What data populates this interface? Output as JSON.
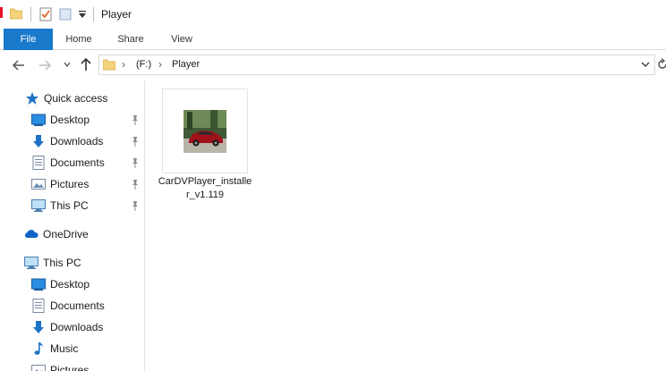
{
  "window": {
    "title": "Player"
  },
  "ribbon": {
    "tabs": [
      {
        "label": "File",
        "active": true
      },
      {
        "label": "Home"
      },
      {
        "label": "Share"
      },
      {
        "label": "View"
      }
    ],
    "accent_color": "#1979ca"
  },
  "address": {
    "segments": [
      "(F:)",
      "Player"
    ],
    "separator": "›"
  },
  "nav": {
    "quick_access": {
      "label": "Quick access",
      "items": [
        {
          "label": "Desktop",
          "icon": "desktop-icon",
          "pinned": true
        },
        {
          "label": "Downloads",
          "icon": "downloads-icon",
          "pinned": true
        },
        {
          "label": "Documents",
          "icon": "documents-icon",
          "pinned": true
        },
        {
          "label": "Pictures",
          "icon": "pictures-icon",
          "pinned": true
        },
        {
          "label": "This PC",
          "icon": "computer-icon",
          "pinned": true
        }
      ]
    },
    "onedrive": {
      "label": "OneDrive"
    },
    "this_pc": {
      "label": "This PC",
      "items": [
        {
          "label": "Desktop",
          "icon": "desktop-icon"
        },
        {
          "label": "Documents",
          "icon": "documents-icon"
        },
        {
          "label": "Downloads",
          "icon": "downloads-icon"
        },
        {
          "label": "Music",
          "icon": "music-icon"
        },
        {
          "label": "Pictures",
          "icon": "pictures-icon"
        }
      ]
    }
  },
  "content": {
    "files": [
      {
        "name": "CarDVPlayer_installer_v1.119",
        "thumbnail": "red-sports-car"
      }
    ]
  }
}
